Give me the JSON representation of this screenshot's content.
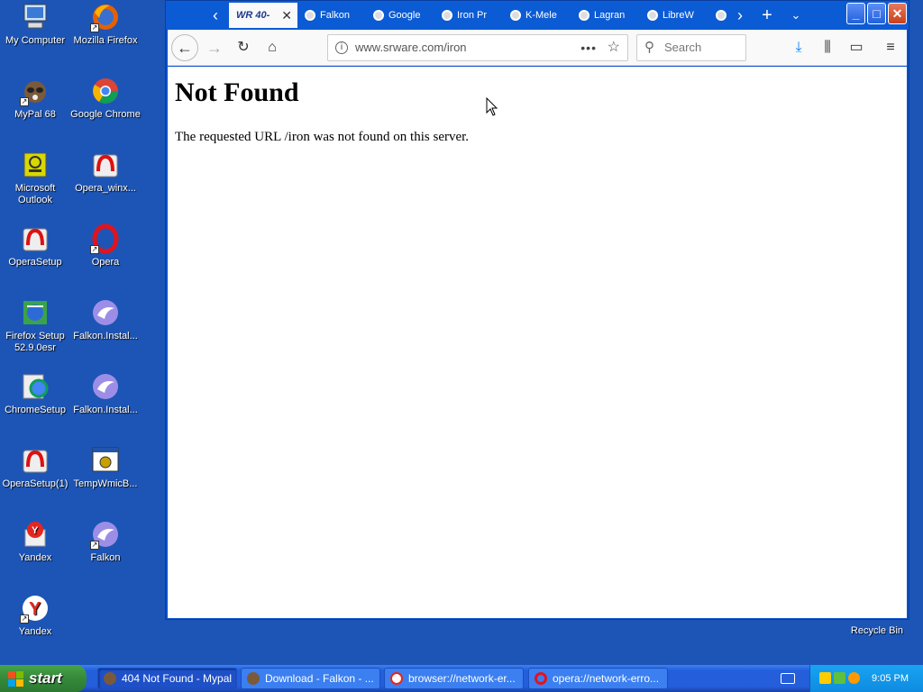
{
  "desktop": {
    "icons": [
      {
        "label": "My Computer"
      },
      {
        "label": "Mozilla Firefox"
      },
      {
        "label": "MyPal 68"
      },
      {
        "label": "Google Chrome"
      },
      {
        "label": "Microsoft Outlook"
      },
      {
        "label": "Opera_winx..."
      },
      {
        "label": "OperaSetup"
      },
      {
        "label": "Opera"
      },
      {
        "label": "Firefox Setup 52.9.0esr"
      },
      {
        "label": "Falkon.Instal..."
      },
      {
        "label": "ChromeSetup"
      },
      {
        "label": "Falkon.Instal..."
      },
      {
        "label": "OperaSetup(1)"
      },
      {
        "label": "TempWmicB..."
      },
      {
        "label": "Yandex"
      },
      {
        "label": "Falkon"
      },
      {
        "label": "Yandex"
      }
    ],
    "recycle_bin": "Recycle Bin"
  },
  "browser": {
    "tabs": [
      {
        "label": "WR 40-",
        "active": true
      },
      {
        "label": "Falkon"
      },
      {
        "label": "Google"
      },
      {
        "label": "Iron Pr"
      },
      {
        "label": "K-Mele"
      },
      {
        "label": "Lagran"
      },
      {
        "label": "LibreW"
      },
      {
        "label": ""
      }
    ],
    "url": "www.srware.com/iron",
    "search_placeholder": "Search",
    "page": {
      "heading": "Not Found",
      "message": "The requested URL /iron was not found on this server."
    }
  },
  "taskbar": {
    "start_label": "start",
    "tasks": [
      {
        "label": "404 Not Found - Mypal",
        "active": true
      },
      {
        "label": "Download - Falkon - ..."
      },
      {
        "label": "browser://network-er..."
      },
      {
        "label": "opera://network-erro..."
      }
    ],
    "clock": "9:05 PM"
  },
  "colors": {
    "desktop_bg": "#1d55b6",
    "taskbar": "#245edb",
    "start_green": "#35883a",
    "tray": "#0e8be0"
  }
}
